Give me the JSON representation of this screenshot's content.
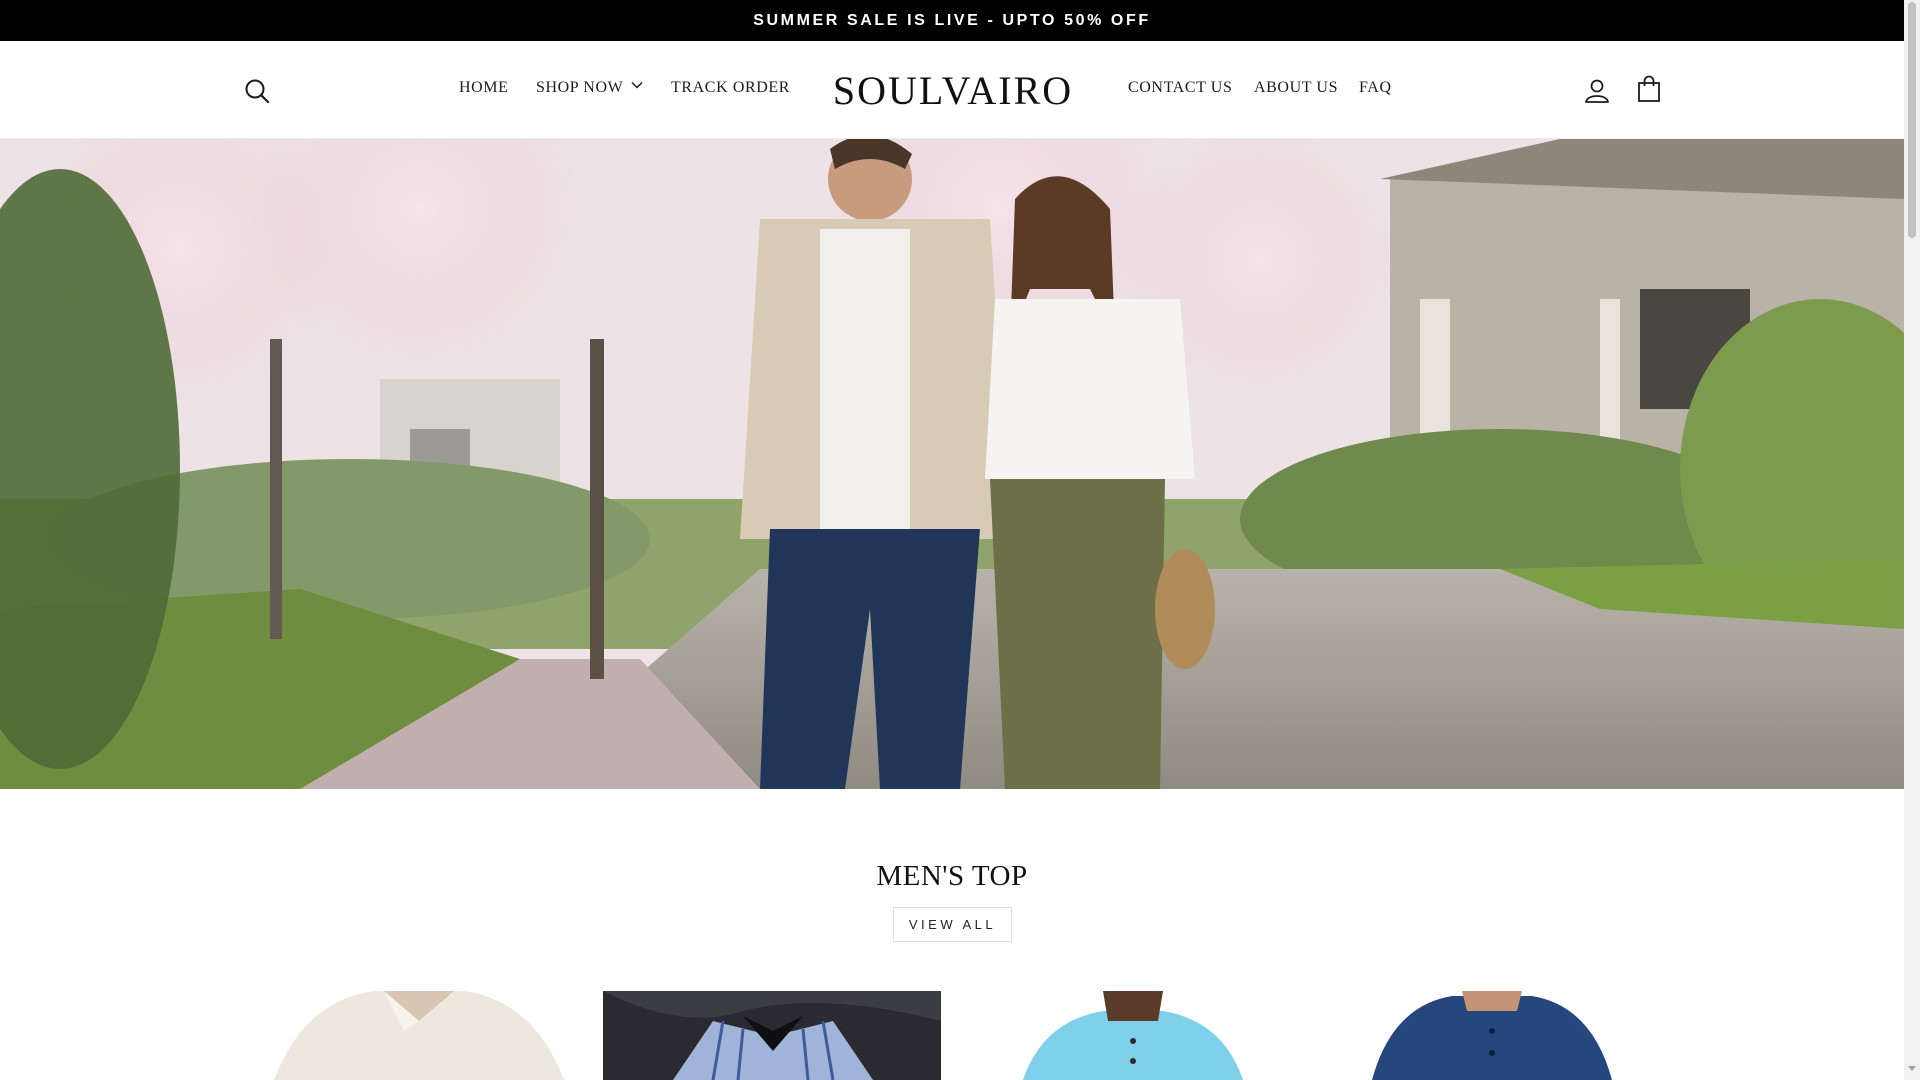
{
  "announcement": {
    "text": "SUMMER SALE IS LIVE - UPTO 50% OFF"
  },
  "header": {
    "logo": "SOULVAIRO",
    "search_icon": "search-icon",
    "account_icon": "user-icon",
    "cart_icon": "shopping-bag-icon",
    "nav_left": [
      {
        "label": "HOME"
      },
      {
        "label": "SHOP NOW",
        "has_dropdown": true
      },
      {
        "label": "TRACK ORDER"
      }
    ],
    "nav_right": [
      {
        "label": "CONTACT US"
      },
      {
        "label": "ABOUT US"
      },
      {
        "label": "FAQ"
      }
    ]
  },
  "hero": {
    "image": "couple-walking-spring-street-photo"
  },
  "section": {
    "title": "MEN'S TOP",
    "view_all_label": "VIEW ALL",
    "products": [
      {
        "image": "cream-linen-shirt"
      },
      {
        "image": "blue-striped-shirt"
      },
      {
        "image": "light-blue-henley-shirt"
      },
      {
        "image": "navy-henley-shirt"
      }
    ]
  },
  "colors": {
    "announcement_bg": "#000000",
    "announcement_text": "#ffffff",
    "text": "#1c1c1c",
    "background": "#ffffff"
  }
}
